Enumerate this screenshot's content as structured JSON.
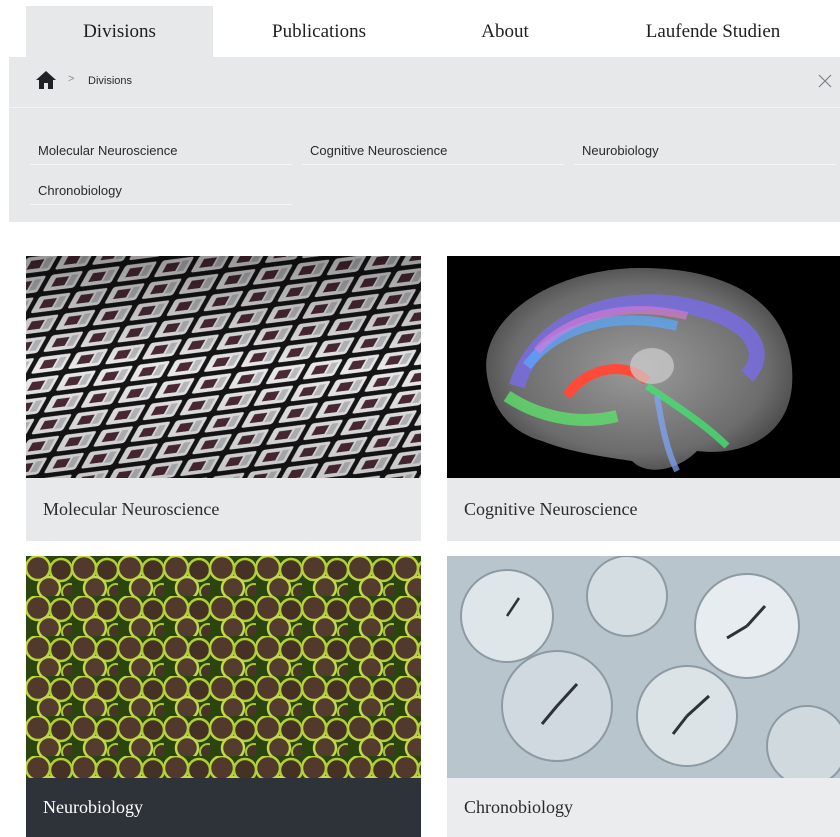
{
  "nav": {
    "tabs": [
      {
        "label": "Divisions",
        "active": true
      },
      {
        "label": "Publications",
        "active": false
      },
      {
        "label": "About",
        "active": false
      },
      {
        "label": "Laufende Studien",
        "active": false
      }
    ]
  },
  "panel": {
    "breadcrumb": {
      "home_icon": "home-icon",
      "separator": ">",
      "current": "Divisions"
    },
    "close_icon": "close-icon",
    "links": [
      "Molecular Neuroscience",
      "Cognitive Neuroscience",
      "Neurobiology",
      "Chronobiology"
    ]
  },
  "cards": [
    {
      "title": "Molecular Neuroscience",
      "image": "microscope-slides-image"
    },
    {
      "title": "Cognitive Neuroscience",
      "image": "brain-tractography-image"
    },
    {
      "title": "Neurobiology",
      "image": "fluorescent-cells-image"
    },
    {
      "title": "Chronobiology",
      "image": "clocks-collage-image"
    }
  ],
  "colors": {
    "panel_bg": "#e7e8ea",
    "dark_caption": "#2d3338"
  }
}
